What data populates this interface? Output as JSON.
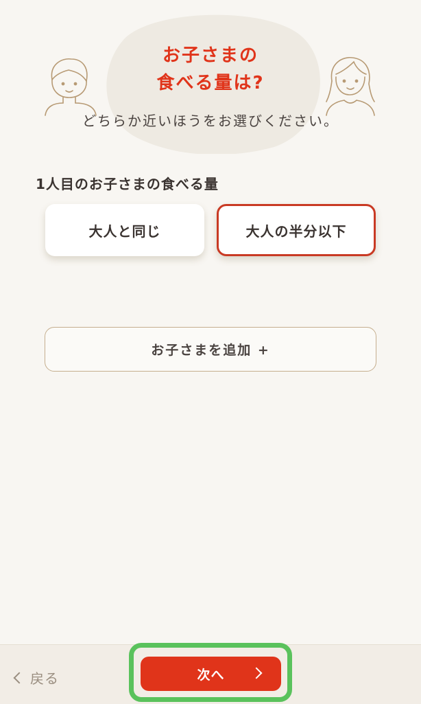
{
  "header": {
    "title_line1": "お子さまの",
    "title_line2": "食べる量は?",
    "subtitle": "どちらか近いほうをお選びください。"
  },
  "section": {
    "label": "1人目のお子さまの食べる量",
    "options": [
      {
        "label": "大人と同じ",
        "selected": false
      },
      {
        "label": "大人の半分以下",
        "selected": true
      }
    ]
  },
  "add_child": {
    "label": "お子さまを追加 +"
  },
  "footer": {
    "back_label": "戻る",
    "next_label": "次へ"
  },
  "colors": {
    "accent": "#e0341a",
    "selected_border": "#c93a24",
    "highlight": "#5ac25c",
    "background": "#f8f6f2"
  },
  "icons": {
    "left_illustration": "boy-face-illustration",
    "right_illustration": "girl-face-illustration",
    "back": "chevron-left-icon",
    "next": "chevron-right-icon"
  }
}
